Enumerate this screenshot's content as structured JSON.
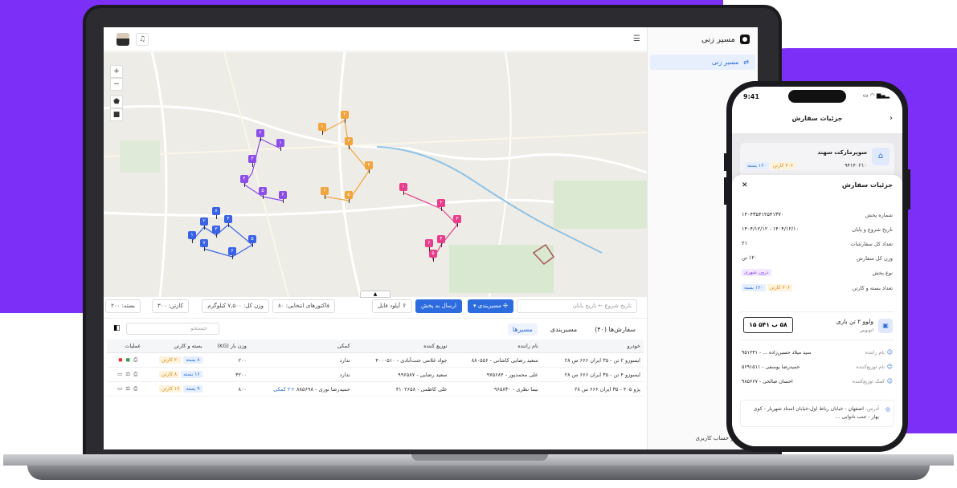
{
  "app": {
    "name": "مسیر زنی",
    "nav": [
      {
        "label": "مسیر زنی"
      }
    ],
    "footer_link": "خروج از حساب کاربری"
  },
  "map": {
    "controls": [
      "+",
      "−",
      "⬟",
      "■"
    ],
    "markers": {
      "purple": [
        "۱",
        "۲",
        "۳",
        "۴",
        "۵",
        "۶"
      ],
      "orange": [
        "۱",
        "۲",
        "۳",
        "۴",
        "۵",
        "۶"
      ],
      "pink": [
        "۱",
        "۲",
        "۳",
        "۴",
        "۵",
        "۶"
      ],
      "blue": [
        "۱",
        "۲",
        "۳",
        "۴",
        "۵",
        "۶",
        "۷",
        "۸"
      ]
    }
  },
  "toolbar": {
    "date_start": "تاریخ شروع",
    "date_end": "تاریخ پایان",
    "routing_button": "مسیربندی",
    "send_button": "ارسال به پخش",
    "upload_button": "آپلود فایل",
    "selected_invoices_label": "فاکتورهای انتخابی:",
    "selected_invoices_value": "۸۰",
    "total_weight_label": "وزن کل:",
    "total_weight_value": "۷,۵۰۰ کیلوگرم",
    "carton_label": "کارتن:",
    "carton_value": "۳۰۰",
    "package_label": "بسته:",
    "package_value": "۲۰۰"
  },
  "orders": {
    "tab_orders": "سفارش‌ها (۴۰)",
    "tab_routing": "مسیربندی",
    "tab_routes": "مسیرها",
    "search_placeholder": "جستجو",
    "columns": [
      "خودرو",
      "نام راننده",
      "توزیع کننده",
      "کمکی",
      "وزن بار (KG)",
      "بسته و کارتن",
      "عملیات"
    ],
    "rows": [
      {
        "vehicle": "ایسوزو ۲ تن - ۳۵ ایران ۶۶۶ س ۲۸",
        "driver": "سعید رضایی کاشانی - ۸۸۰۵۵۶",
        "distributor": "جواد غلامی جنت‌آبادی - ۴۰۰۰۵۱۰",
        "helper": "ندارد",
        "helper_extra": "",
        "weight": "۲۰۰",
        "package": "۸ بسته",
        "carton": "۲۰ کارتن"
      },
      {
        "vehicle": "ایسوزو ۴ تن - ۳۵ ایران ۶۶۶ س ۲۸",
        "driver": "علی محمدپور - ۹۷۵۶۸۴",
        "distributor": "سعید رضایی - ۹۹۶۵۸۷",
        "helper": "ندارد",
        "helper_extra": "",
        "weight": "۳۲۰۰",
        "package": "۱۶ بسته",
        "carton": "۸ کارتن"
      },
      {
        "vehicle": "پژو ۴۰۵ - ۳۵ ایران ۶۶۶ س ۲۸",
        "driver": "نیما نظری - ۹۶۵۸۳۰",
        "distributor": "علی کاظمی - ۴۱۰۲۶۵۸",
        "helper": "حمیدرضا نوری - ۸۸۵۶۹۸",
        "helper_extra": "+۲ کمکی",
        "weight": "۸۰۰",
        "package": "۹ بسته",
        "carton": "۱۶ کارتن"
      }
    ]
  },
  "phone": {
    "time": "9:41",
    "header_title": "جزئیات سفارش",
    "store_name": "سوپرمارکت سهند",
    "store_code": "۹۴۱۴۰۲۱۰",
    "store_package": "۱۲۰ بسته",
    "store_carton": "۳۰۶ کارتن",
    "sheet_title": "جزئیات سفارش",
    "fields": [
      {
        "label": "شماره پخش",
        "value": "۱۴۰۴۳۵۴۱۲۵۴۱۳۷۰"
      },
      {
        "label": "تاریخ شروع و پایان",
        "value": "۱۴۰۴/۱۲/۱۰ - ۱۴۰۴/۱۲/۱۲"
      },
      {
        "label": "تعداد کل سفارشات",
        "value": "۲۱"
      },
      {
        "label": "وزن کل سفارش",
        "value": "۱۲۰ تن"
      }
    ],
    "dist_type_label": "نوع پخش",
    "dist_type_value": "درون شهری",
    "count_label": "تعداد بسته و کارتن",
    "count_package": "۱۲۰ بسته",
    "count_carton": "۳۰۶ کارتن",
    "vehicle_name": "ولوو ۲ تن باری",
    "vehicle_sub": "اتوبوس",
    "plate": "۵۸ ب ۵۴۱ ۱۵",
    "people": [
      {
        "label": "نام راننده",
        "value": "سید میلاد حسین‌زاده ... - ۹۵۱۲۳۱"
      },
      {
        "label": "نام توزیع‌کننده",
        "value": "حمیدرضا یوسفی - ۵۶۹۱۵۱۱"
      },
      {
        "label": "کمک توزیع‌کننده",
        "value": "احسان صالحی - ۹۸۵۶۶۷"
      }
    ],
    "address_label": "آدرس:",
    "address_value": "اصفهان - خیابان رباط اول-خیابان استاد شهریار - کوی بهار - جنب نانوایی ..."
  }
}
